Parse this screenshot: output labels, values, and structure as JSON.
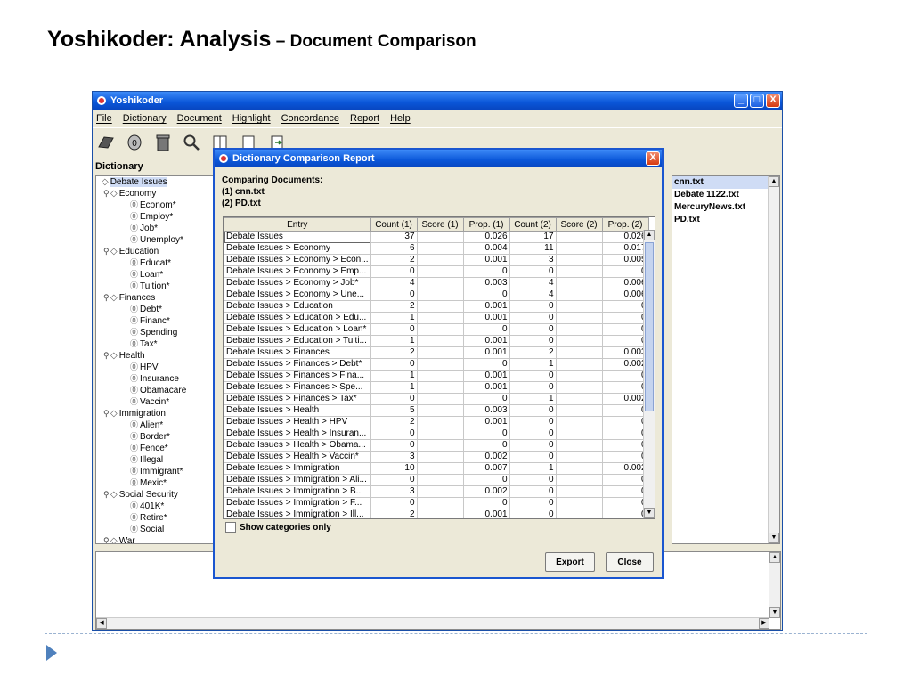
{
  "slide": {
    "title_main": "Yoshikoder: Analysis",
    "title_sub": " – Document Comparison"
  },
  "app": {
    "title": "Yoshikoder",
    "window_buttons": [
      "_",
      "□",
      "X"
    ],
    "menu": [
      "File",
      "Dictionary",
      "Document",
      "Highlight",
      "Concordance",
      "Report",
      "Help"
    ],
    "toolbar_icons": [
      "dictionary-icon",
      "pattern-icon",
      "trash-icon",
      "search-icon",
      "columns-icon",
      "document-icon",
      "export-document-icon"
    ],
    "dictionary_label": "Dictionary",
    "tree": [
      {
        "label": "Debate Issues",
        "level": 0
      },
      {
        "label": "Economy",
        "level": 1
      },
      {
        "label": "Econom*",
        "level": 2
      },
      {
        "label": "Employ*",
        "level": 2
      },
      {
        "label": "Job*",
        "level": 2
      },
      {
        "label": "Unemploy*",
        "level": 2
      },
      {
        "label": "Education",
        "level": 1
      },
      {
        "label": "Educat*",
        "level": 2
      },
      {
        "label": "Loan*",
        "level": 2
      },
      {
        "label": "Tuition*",
        "level": 2
      },
      {
        "label": "Finances",
        "level": 1
      },
      {
        "label": "Debt*",
        "level": 2
      },
      {
        "label": "Financ*",
        "level": 2
      },
      {
        "label": "Spending",
        "level": 2
      },
      {
        "label": "Tax*",
        "level": 2
      },
      {
        "label": "Health",
        "level": 1
      },
      {
        "label": "HPV",
        "level": 2
      },
      {
        "label": "Insurance",
        "level": 2
      },
      {
        "label": "Obamacare",
        "level": 2
      },
      {
        "label": "Vaccin*",
        "level": 2
      },
      {
        "label": "Immigration",
        "level": 1
      },
      {
        "label": "Alien*",
        "level": 2
      },
      {
        "label": "Border*",
        "level": 2
      },
      {
        "label": "Fence*",
        "level": 2
      },
      {
        "label": "Illegal",
        "level": 2
      },
      {
        "label": "Immigrant*",
        "level": 2
      },
      {
        "label": "Mexic*",
        "level": 2
      },
      {
        "label": "Social Security",
        "level": 1
      },
      {
        "label": "401K*",
        "level": 2
      },
      {
        "label": "Retire*",
        "level": 2
      },
      {
        "label": "Social",
        "level": 2
      },
      {
        "label": "War",
        "level": 1
      }
    ],
    "files": [
      "cnn.txt",
      "Debate 1122.txt",
      "MercuryNews.txt",
      "PD.txt"
    ]
  },
  "dialog": {
    "title": "Dictionary Comparison Report",
    "close": "X",
    "header_line1": "Comparing Documents:",
    "header_line2": "(1) cnn.txt",
    "header_line3": "(2) PD.txt",
    "columns": [
      "Entry",
      "Count (1)",
      "Score (1)",
      "Prop. (1)",
      "Count (2)",
      "Score (2)",
      "Prop. (2)"
    ],
    "rows": [
      [
        "Debate Issues",
        "37",
        "",
        "0.026",
        "17",
        "",
        "0.026"
      ],
      [
        "Debate Issues > Economy",
        "6",
        "",
        "0.004",
        "11",
        "",
        "0.017"
      ],
      [
        "Debate Issues > Economy > Econ...",
        "2",
        "",
        "0.001",
        "3",
        "",
        "0.005"
      ],
      [
        "Debate Issues > Economy > Emp...",
        "0",
        "",
        "0",
        "0",
        "",
        "0"
      ],
      [
        "Debate Issues > Economy > Job*",
        "4",
        "",
        "0.003",
        "4",
        "",
        "0.006"
      ],
      [
        "Debate Issues > Economy > Une...",
        "0",
        "",
        "0",
        "4",
        "",
        "0.006"
      ],
      [
        "Debate Issues > Education",
        "2",
        "",
        "0.001",
        "0",
        "",
        "0"
      ],
      [
        "Debate Issues > Education > Edu...",
        "1",
        "",
        "0.001",
        "0",
        "",
        "0"
      ],
      [
        "Debate Issues > Education > Loan*",
        "0",
        "",
        "0",
        "0",
        "",
        "0"
      ],
      [
        "Debate Issues > Education > Tuiti...",
        "1",
        "",
        "0.001",
        "0",
        "",
        "0"
      ],
      [
        "Debate Issues > Finances",
        "2",
        "",
        "0.001",
        "2",
        "",
        "0.003"
      ],
      [
        "Debate Issues > Finances > Debt*",
        "0",
        "",
        "0",
        "1",
        "",
        "0.002"
      ],
      [
        "Debate Issues > Finances > Fina...",
        "1",
        "",
        "0.001",
        "0",
        "",
        "0"
      ],
      [
        "Debate Issues > Finances > Spe...",
        "1",
        "",
        "0.001",
        "0",
        "",
        "0"
      ],
      [
        "Debate Issues > Finances > Tax*",
        "0",
        "",
        "0",
        "1",
        "",
        "0.002"
      ],
      [
        "Debate Issues > Health",
        "5",
        "",
        "0.003",
        "0",
        "",
        "0"
      ],
      [
        "Debate Issues > Health > HPV",
        "2",
        "",
        "0.001",
        "0",
        "",
        "0"
      ],
      [
        "Debate Issues > Health > Insuran...",
        "0",
        "",
        "0",
        "0",
        "",
        "0"
      ],
      [
        "Debate Issues > Health > Obama...",
        "0",
        "",
        "0",
        "0",
        "",
        "0"
      ],
      [
        "Debate Issues > Health > Vaccin*",
        "3",
        "",
        "0.002",
        "0",
        "",
        "0"
      ],
      [
        "Debate Issues > Immigration",
        "10",
        "",
        "0.007",
        "1",
        "",
        "0.002"
      ],
      [
        "Debate Issues > Immigration > Ali...",
        "0",
        "",
        "0",
        "0",
        "",
        "0"
      ],
      [
        "Debate Issues > Immigration > B...",
        "3",
        "",
        "0.002",
        "0",
        "",
        "0"
      ],
      [
        "Debate Issues > Immigration > F...",
        "0",
        "",
        "0",
        "0",
        "",
        "0"
      ],
      [
        "Debate Issues > Immigration > Ill...",
        "2",
        "",
        "0.001",
        "0",
        "",
        "0"
      ]
    ],
    "show_categories_label": "Show categories only",
    "export_label": "Export",
    "close_label": "Close"
  },
  "colors": {
    "titlebar": "#0a56d8",
    "accent_bullet": "#4f81bd",
    "selection": "#cfdcf5"
  }
}
